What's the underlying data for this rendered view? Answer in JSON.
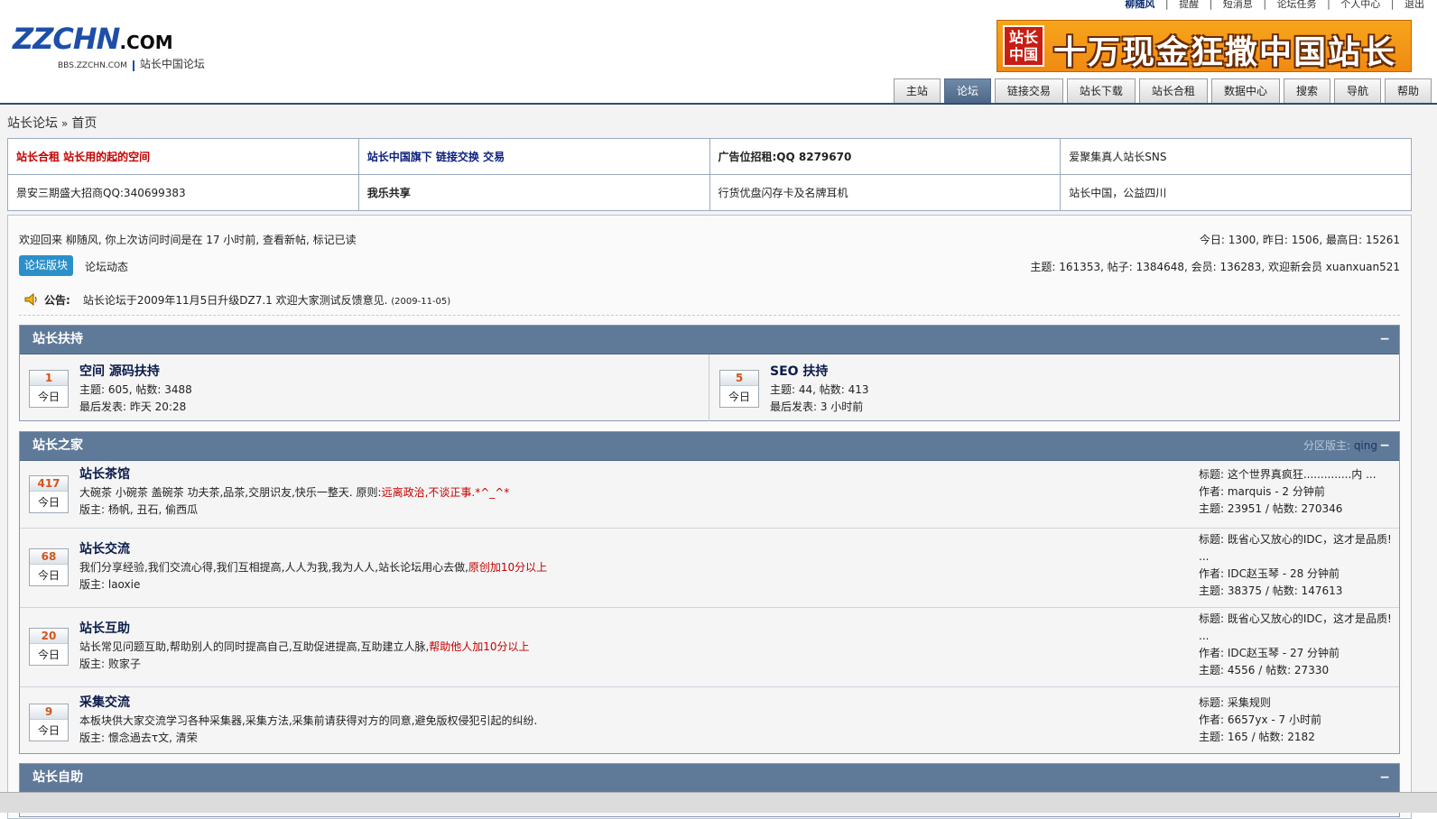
{
  "topbar": {
    "user": "柳随风",
    "links": [
      "提醒",
      "短消息",
      "论坛任务",
      "个人中心",
      "退出"
    ]
  },
  "logo": {
    "main": "ZZCHN",
    "dotcom": ".COM",
    "site": "BBS.ZZCHN.COM",
    "name": "站长中国论坛"
  },
  "banner": {
    "badge": "站长中国",
    "slogan": "十万现金狂撒中国站长"
  },
  "nav": {
    "tabs": [
      "主站",
      "论坛",
      "链接交易",
      "站长下载",
      "站长合租",
      "数据中心",
      "搜索",
      "导航",
      "帮助"
    ]
  },
  "breadcrumb": {
    "root": "站长论坛",
    "sep": "»",
    "current": "首页"
  },
  "ads": [
    [
      "站长合租 站长用的起的空间",
      "站长中国旗下 链接交换 交易",
      "广告位招租:QQ 8279670",
      "爱聚集真人站长SNS"
    ],
    [
      "景安三期盛大招商QQ:340699383",
      "我乐共享",
      "行货优盘闪存卡及名牌耳机",
      "站长中国，公益四川"
    ]
  ],
  "welcome": "欢迎回来 柳随风, 你上次访问时间是在 17 小时前, 查看新帖, 标记已读",
  "stats": {
    "today": "今日: 1300, 昨日: 1506, 最高日: 15261",
    "total": "主题: 161353, 帖子: 1384648, 会员: 136283, 欢迎新会员 xuanxuan521"
  },
  "tabs": {
    "boards": "论坛版块",
    "activity": "论坛动态"
  },
  "announce": {
    "label": "公告:",
    "text": "站长论坛于2009年11月5日升级DZ7.1 欢迎大家测试反馈意见.",
    "date": "(2009-11-05)"
  },
  "today_label": "今日",
  "sections": [
    {
      "title": "站长扶持",
      "collapse": "−",
      "boards": [
        {
          "count": "1",
          "name": "空间 源码扶持",
          "stats": "主题: 605, 帖数: 3488",
          "last": "最后发表: 昨天 20:28"
        },
        {
          "count": "5",
          "name": "SEO 扶持",
          "stats": "主题: 44, 帖数: 413",
          "last": "最后发表: 3 小时前"
        }
      ]
    },
    {
      "title": "站长之家",
      "mods_label": "分区版主:",
      "mods": "qing",
      "collapse": "−",
      "boards": [
        {
          "count": "417",
          "name": "站长茶馆",
          "desc": "大碗茶 小碗茶 盖碗茶 功夫茶,品茶,交朋识友,快乐一整天. 原则:",
          "desc_hl": "远离政治,不谈正事.*^_^*",
          "moderators": "版主: 杨帆, 丑石, 偷西瓜",
          "last_title": "标题: 这个世界真疯狂..............内 ...",
          "last_title_cont": "",
          "last_author": "作者: marquis - 2 分钟前",
          "last_stats": "主题: 23951 / 帖数: 270346"
        },
        {
          "count": "68",
          "name": "站长交流",
          "desc": "我们分享经验,我们交流心得,我们互相提高,人人为我,我为人人,站长论坛用心去做,",
          "desc_hl": "原创加10分以上",
          "moderators": "版主: laoxie",
          "last_title": "标题: 既省心又放心的IDC，这才是品质!",
          "last_title_cont": "...",
          "last_author": "作者: IDC赵玉琴 - 28 分钟前",
          "last_stats": "主题: 38375 / 帖数: 147613"
        },
        {
          "count": "20",
          "name": "站长互助",
          "desc": "站长常见问题互助,帮助别人的同时提高自己,互助促进提高,互助建立人脉,",
          "desc_hl": "帮助他人加10分以上",
          "moderators": "版主: 败家子",
          "last_title": "标题: 既省心又放心的IDC，这才是品质!",
          "last_title_cont": "...",
          "last_author": "作者: IDC赵玉琴 - 27 分钟前",
          "last_stats": "主题: 4556 / 帖数: 27330"
        },
        {
          "count": "9",
          "name": "采集交流",
          "desc": "本板块供大家交流学习各种采集器,采集方法,采集前请获得对方的同意,避免版权侵犯引起的纠纷.",
          "desc_hl": "",
          "moderators": "版主: 憬念過去τ文, 清荣",
          "last_title": "标题: 采集规则",
          "last_title_cont": "",
          "last_author": "作者: 6657yx - 7 小时前",
          "last_stats": "主题: 165 / 帖数: 2182"
        }
      ]
    },
    {
      "title": "站长自助",
      "collapse": "−"
    }
  ]
}
